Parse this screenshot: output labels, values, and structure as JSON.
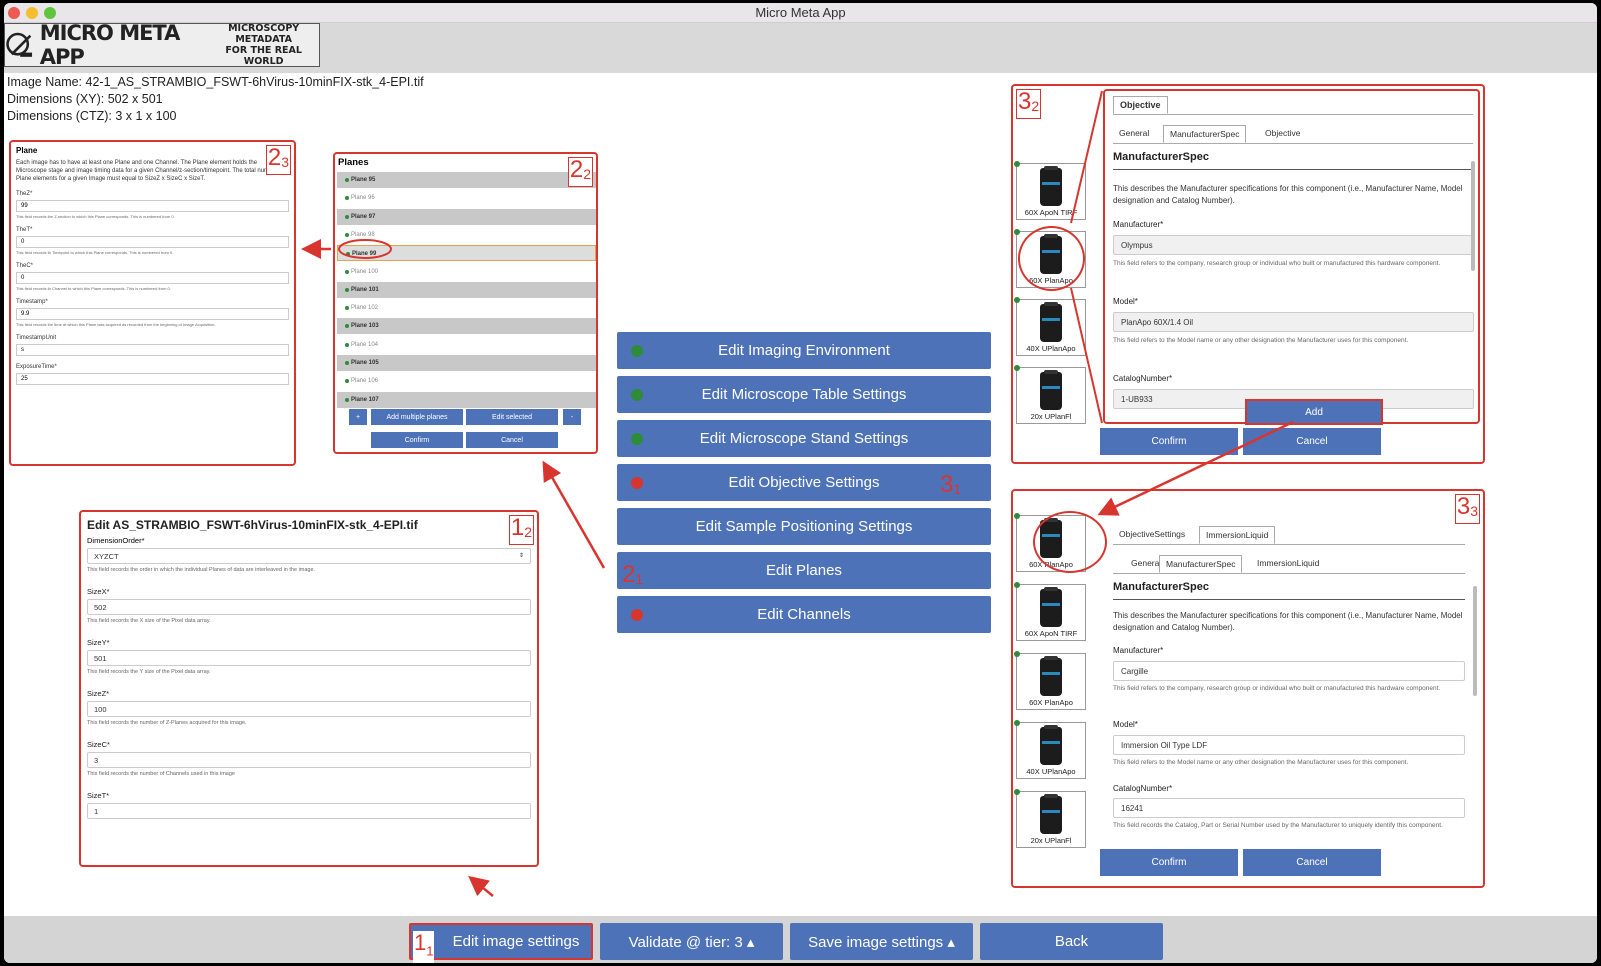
{
  "window": {
    "title": "Micro Meta App"
  },
  "logo": {
    "main": "MICRO META APP",
    "sub1": "MICROSCOPY METADATA",
    "sub2": "FOR THE REAL WORLD"
  },
  "image_info": {
    "name": "Image Name: 42-1_AS_STRAMBIO_FSWT-6hVirus-10minFIX-stk_4-EPI.tif",
    "dims_xy": "Dimensions (XY): 502 x 501",
    "dims_ctz": "Dimensions (CTZ): 3 x 1 x 100"
  },
  "menu": {
    "items": [
      {
        "label": "Edit Imaging Environment",
        "status": "green"
      },
      {
        "label": "Edit Microscope Table Settings",
        "status": "green"
      },
      {
        "label": "Edit Microscope Stand Settings",
        "status": "green"
      },
      {
        "label": "Edit Objective Settings",
        "status": "red"
      },
      {
        "label": "Edit Sample Positioning Settings",
        "status": ""
      },
      {
        "label": "Edit Planes",
        "status": ""
      },
      {
        "label": "Edit Channels",
        "status": "red"
      }
    ]
  },
  "callouts": {
    "c11": "1",
    "c11s": "1",
    "c12": "1",
    "c12s": "2",
    "c21": "2",
    "c21s": "1",
    "c22": "2",
    "c22s": "2",
    "c23": "2",
    "c23s": "3",
    "c31": "3",
    "c31s": "1",
    "c32": "3",
    "c32s": "2",
    "c33": "3",
    "c33s": "3"
  },
  "plane_panel": {
    "title": "Plane",
    "desc": "Each image has to have at least one Plane and one Channel. The Plane element holds the Microscope stage and image timing data for a given Channel/z-section/timepoint. The total number of Plane elements for a given Image must equal to SizeZ x SizeC x SizeT.",
    "fields": [
      {
        "label": "TheZ*",
        "value": "99",
        "help": "This field records the Z-section to which this Plane corresponds. This is numbered from 0."
      },
      {
        "label": "TheT*",
        "value": "0",
        "help": "This field records th Timepoint to which this Plane corresponds. This is numbered from 0."
      },
      {
        "label": "TheC*",
        "value": "0",
        "help": "This field records th Channel to which this Plane corresponds. This is numbered from 0."
      },
      {
        "label": "Timestamp*",
        "value": "9.9",
        "help": "This field records the time at which this Plane was acquired as recorded from the beginning of Image Acquisition."
      },
      {
        "label": "TimestampUnit",
        "value": "s",
        "help": ""
      },
      {
        "label": "ExposureTime*",
        "value": "25",
        "help": ""
      }
    ]
  },
  "planes_panel": {
    "title": "Planes",
    "rows": [
      "Plane 95",
      "Plane 96",
      "Plane 97",
      "Plane 98",
      "Plane 99",
      "Plane 100",
      "Plane 101",
      "Plane 102",
      "Plane 103",
      "Plane 104",
      "Plane 105",
      "Plane 106",
      "Plane 107"
    ],
    "plus": "+",
    "add_multiple": "Add multiple planes",
    "edit_selected": "Edit selected",
    "minus": "-",
    "confirm": "Confirm",
    "cancel": "Cancel"
  },
  "edit_image": {
    "title": "Edit AS_STRAMBIO_FSWT-6hVirus-10minFIX-stk_4-EPI.tif",
    "dim_label": "DimensionOrder*",
    "dim_value": "XYZCT",
    "dim_help": "This field records the order in which the individual Planes of data are interleaved in the image.",
    "fields": [
      {
        "label": "SizeX*",
        "value": "502",
        "help": "This field records the X size of the Pixel data array."
      },
      {
        "label": "SizeY*",
        "value": "501",
        "help": "This field records the Y size of the Pixel data array."
      },
      {
        "label": "SizeZ*",
        "value": "100",
        "help": "This field records the number of Z-Planes acquired for this image."
      },
      {
        "label": "SizeC*",
        "value": "3",
        "help": "This field records the number of Channels used in this image"
      },
      {
        "label": "SizeT*",
        "value": "1",
        "help": ""
      }
    ]
  },
  "objective_panel": {
    "outer_tab": "Objective",
    "tabs": [
      "General",
      "ManufacturerSpec",
      "Objective"
    ],
    "section": "ManufacturerSpec",
    "desc": "This describes the Manufacturer specifications for this component (i.e., Manufacturer Name, Model designation and Catalog Number).",
    "manufacturer_label": "Manufacturer*",
    "manufacturer_value": "Olympus",
    "manufacturer_help": "This field refers to the company, research group or individual who built or manufactured this hardware component.",
    "model_label": "Model*",
    "model_value": "PlanApo 60X/1.4 Oil",
    "model_help": "This field refers to the Model name or any other designation the Manufacturer uses for this component.",
    "catalog_label": "CatalogNumber*",
    "catalog_value": "1-UB933",
    "thumbs": [
      "60X ApoN TIRF",
      "60X PlanApo",
      "40X UPlanApo",
      "20x UPlanFl"
    ],
    "add": "Add",
    "confirm": "Confirm",
    "cancel": "Cancel"
  },
  "immersion_panel": {
    "outer_tabs": [
      "ObjectiveSettings",
      "ImmersionLiquid"
    ],
    "tabs": [
      "General",
      "ManufacturerSpec",
      "ImmersionLiquid"
    ],
    "section": "ManufacturerSpec",
    "desc": "This describes the Manufacturer specifications for this component (i.e., Manufacturer Name, Model designation and Catalog Number).",
    "manufacturer_label": "Manufacturer*",
    "manufacturer_value": "Cargille",
    "manufacturer_help": "This field refers to the company, research group or individual who built or manufactured this hardware component.",
    "model_label": "Model*",
    "model_value": "Immersion Oil Type LDF",
    "model_help": "This field refers to the Model name or any other designation the Manufacturer uses for this component.",
    "catalog_label": "CatalogNumber*",
    "catalog_value": "16241",
    "catalog_help": "This field records the Catalog, Part or Serial Number used by the Manufacturer to uniquely identify this component.",
    "thumbs": [
      "60X PlanApo",
      "60X ApoN TIRF",
      "60X PlanApo",
      "40X UPlanApo",
      "20x UPlanFl"
    ],
    "confirm": "Confirm",
    "cancel": "Cancel"
  },
  "bottom": {
    "edit_image": "Edit image settings",
    "validate": "Validate @ tier: 3 ▴",
    "save": "Save image settings ▴",
    "back": "Back"
  },
  "colors": {
    "accent": "#4e72b8",
    "callout": "#d9352f",
    "ok": "#2e8b3a",
    "error": "#d9352f"
  }
}
